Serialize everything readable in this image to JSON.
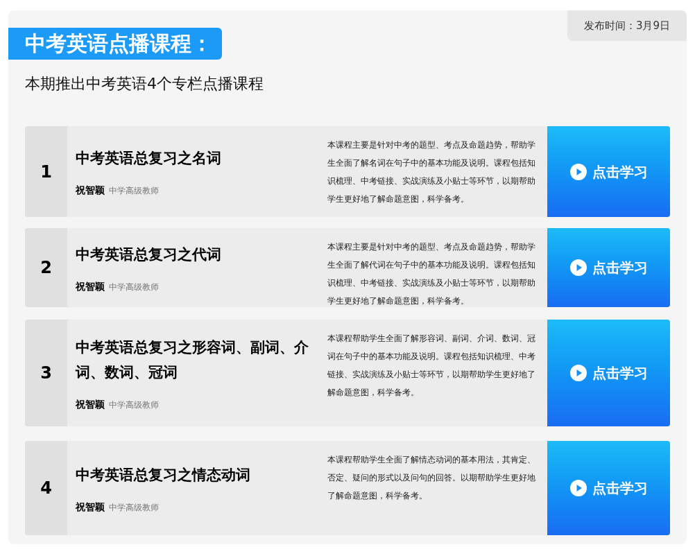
{
  "publish_time": "发布时间：3月9日",
  "heading": "中考英语点播课程：",
  "subtitle": "本期推出中考英语4个专栏点播课程",
  "courses": [
    {
      "number": "1",
      "title": "中考英语总复习之名词",
      "teacher": "祝智颖",
      "teacher_title": "中学高级教师",
      "description": "本课程主要是针对中考的题型、考点及命题趋势，帮助学生全面了解名词在句子中的基本功能及说明。课程包括知识梳理、中考链接、实战演练及小贴士等环节，以期帮助学生更好地了解命题意图，科学备考。",
      "button": "点击学习"
    },
    {
      "number": "2",
      "title": "中考英语总复习之代词",
      "teacher": "祝智颖",
      "teacher_title": "中学高级教师",
      "description": "本课程主要是针对中考的题型、考点及命题趋势，帮助学生全面了解代词在句子中的基本功能及说明。课程包括知识梳理、中考链接、实战演练及小贴士等环节，以期帮助学生更好地了解命题意图，科学备考。",
      "button": "点击学习"
    },
    {
      "number": "3",
      "title": "中考英语总复习之形容词、副词、介词、数词、冠词",
      "teacher": "祝智颖",
      "teacher_title": "中学高级教师",
      "description": "本课程帮助学生全面了解形容词、副词、介词、数词、冠词在句子中的基本功能及说明。课程包括知识梳理、中考链接、实战演练及小贴士等环节，以期帮助学生更好地了解命题意图，科学备考。",
      "button": "点击学习"
    },
    {
      "number": "4",
      "title": "中考英语总复习之情态动词",
      "teacher": "祝智颖",
      "teacher_title": "中学高级教师",
      "description": "本课程帮助学生全面了解情态动词的基本用法，其肯定、否定、疑问的形式以及问句的回答。以期帮助学生更好地了解命题意图，科学备考。",
      "button": "点击学习"
    }
  ]
}
